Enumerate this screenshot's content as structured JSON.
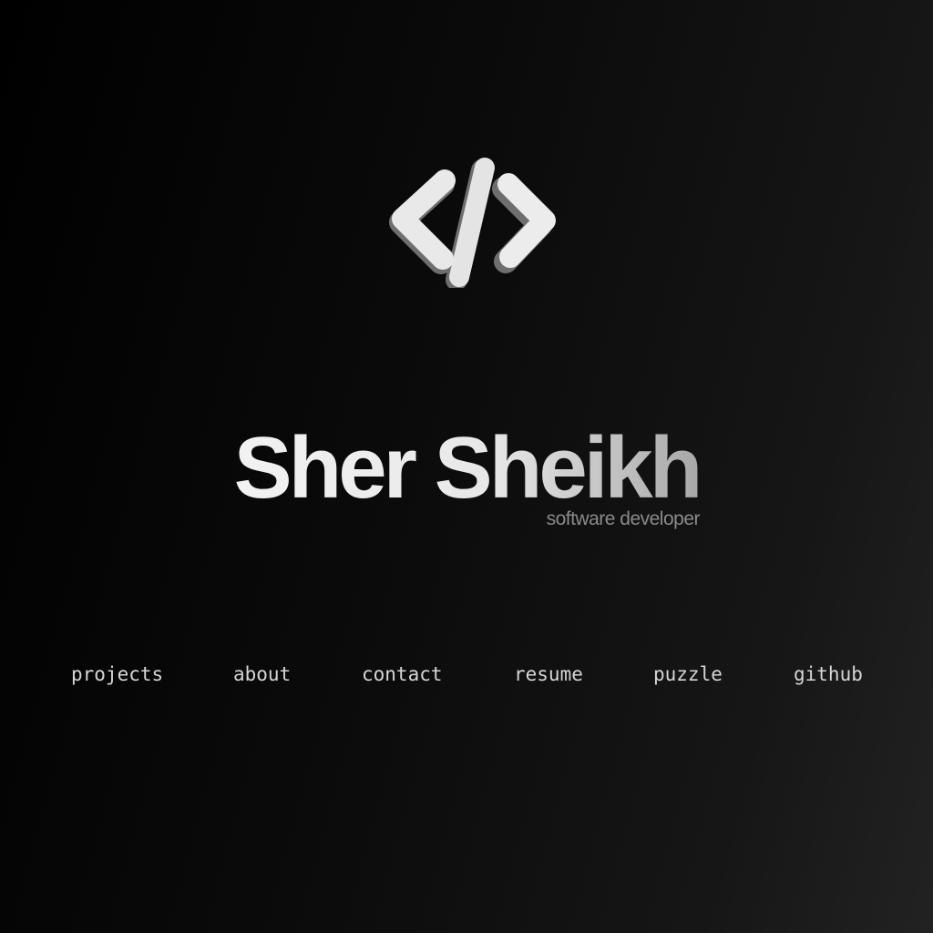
{
  "logo": {
    "icon": "code-brackets-icon"
  },
  "hero": {
    "name": "Sher Sheikh",
    "subtitle": "software developer"
  },
  "nav": {
    "items": [
      {
        "label": "projects"
      },
      {
        "label": "about"
      },
      {
        "label": "contact"
      },
      {
        "label": "resume"
      },
      {
        "label": "puzzle"
      },
      {
        "label": "github"
      }
    ]
  },
  "colors": {
    "background_dark": "#000000",
    "background_light": "#222222",
    "text_primary": "#e6e6e6",
    "text_muted": "#8a8a8a",
    "nav_text": "#d6d6d6"
  }
}
